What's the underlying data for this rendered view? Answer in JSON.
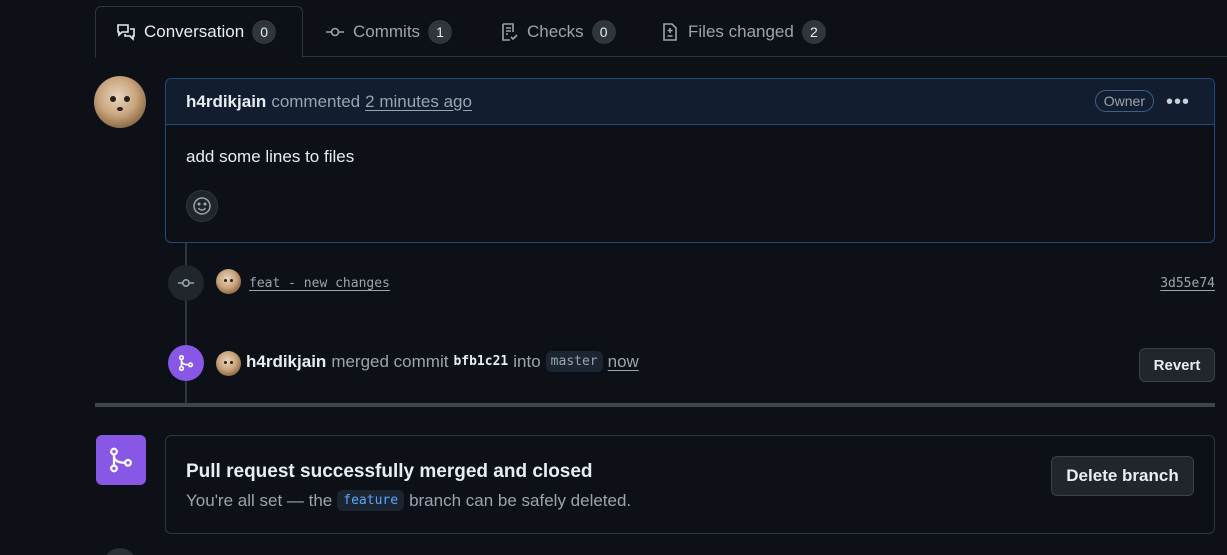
{
  "tabs": [
    {
      "label": "Conversation",
      "count": "0",
      "icon": "comment-discussion-icon",
      "active": true
    },
    {
      "label": "Commits",
      "count": "1",
      "icon": "git-commit-icon"
    },
    {
      "label": "Checks",
      "count": "0",
      "icon": "checklist-icon"
    },
    {
      "label": "Files changed",
      "count": "2",
      "icon": "file-diff-icon"
    }
  ],
  "comment": {
    "author": "h4rdikjain",
    "action": "commented",
    "time": "2 minutes ago",
    "badge": "Owner",
    "body": "add some lines to files"
  },
  "commit": {
    "message": "feat - new changes",
    "sha": "3d55e74"
  },
  "merge_event": {
    "author": "h4rdikjain",
    "action": "merged commit",
    "sha": "bfb1c21",
    "into": "into",
    "branch": "master",
    "time": "now",
    "revert_label": "Revert"
  },
  "merged_box": {
    "title": "Pull request successfully merged and closed",
    "desc_prefix": "You're all set — the",
    "branch": "feature",
    "desc_suffix": "branch can be safely deleted.",
    "delete_label": "Delete branch"
  },
  "colors": {
    "background": "#0d1117",
    "accent_purple": "#8957e5",
    "comment_border": "#1f4a7a"
  }
}
